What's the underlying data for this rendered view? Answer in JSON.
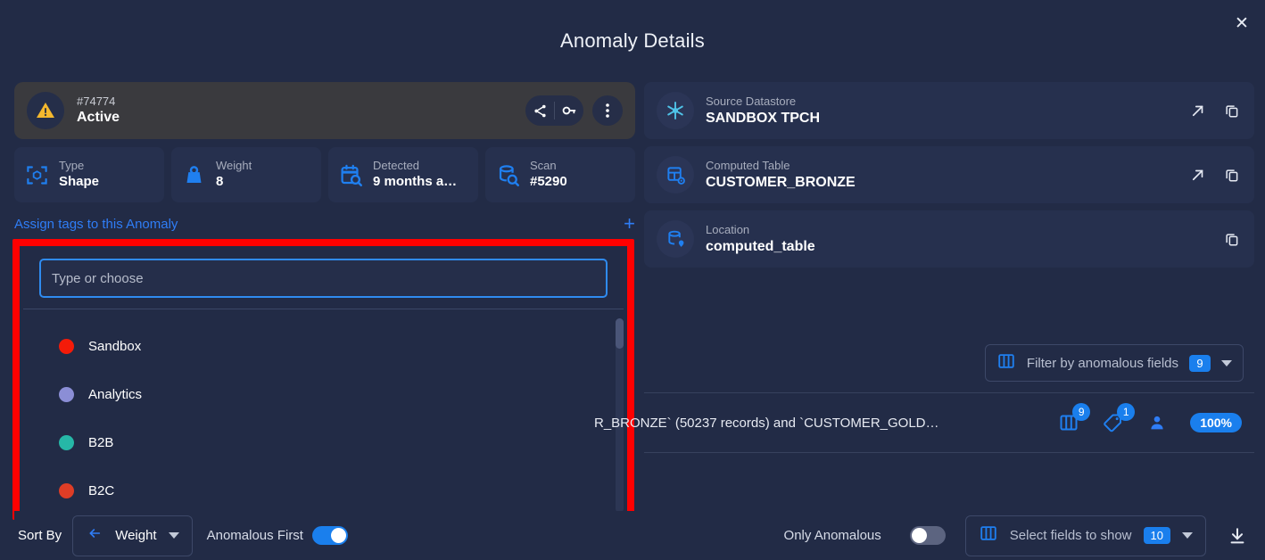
{
  "header": {
    "title": "Anomaly Details",
    "close_label": "✕"
  },
  "status": {
    "id": "#74774",
    "state": "Active",
    "icon": "warning-triangle-icon",
    "actions": [
      "share-icon",
      "key-icon",
      "more-vertical-icon"
    ]
  },
  "metrics": [
    {
      "label": "Type",
      "value": "Shape",
      "icon": "shape-scan-icon"
    },
    {
      "label": "Weight",
      "value": "8",
      "icon": "weight-icon"
    },
    {
      "label": "Detected",
      "value": "9 months a…",
      "icon": "calendar-search-icon"
    },
    {
      "label": "Scan",
      "value": "#5290",
      "icon": "database-search-icon"
    }
  ],
  "tags_section": {
    "assign_label": "Assign tags to this Anomaly",
    "add_label": "+",
    "input_placeholder": "Type or choose",
    "input_value": "",
    "options": [
      {
        "label": "Sandbox",
        "color": "#f41b09"
      },
      {
        "label": "Analytics",
        "color": "#8b8ed6"
      },
      {
        "label": "B2B",
        "color": "#26b7a7"
      },
      {
        "label": "B2C",
        "color": "#de3d26"
      }
    ],
    "highlight_color": "#ff0000"
  },
  "info_cards": [
    {
      "label": "Source Datastore",
      "value": "SANDBOX TPCH",
      "icon": "snowflake-icon",
      "actions": [
        "open-external-icon",
        "copy-icon"
      ]
    },
    {
      "label": "Computed Table",
      "value": "CUSTOMER_BRONZE",
      "icon": "computed-table-icon",
      "actions": [
        "open-external-icon",
        "copy-icon"
      ]
    },
    {
      "label": "Location",
      "value": "computed_table",
      "icon": "database-pin-icon",
      "actions": [
        "copy-icon"
      ]
    }
  ],
  "filter": {
    "label": "Filter by anomalous fields",
    "count": "9",
    "icon": "columns-icon"
  },
  "record": {
    "text": "R_BRONZE` (50237 records) and `CUSTOMER_GOLD…",
    "badges": [
      {
        "icon": "columns-icon",
        "count": "9"
      },
      {
        "icon": "tag-icon",
        "count": "1"
      },
      {
        "icon": "user-icon",
        "count": ""
      }
    ],
    "percent": "100%"
  },
  "bottom": {
    "sort_by_label": "Sort By",
    "sort_direction_icon": "arrow-left-icon",
    "sort_value": "Weight",
    "anomalous_first_label": "Anomalous First",
    "anomalous_first_on": true,
    "only_anomalous_label": "Only Anomalous",
    "only_anomalous_on": false,
    "select_fields_label": "Select fields to show",
    "select_fields_count": "10",
    "download_icon": "download-icon"
  },
  "colors": {
    "background": "#222b46",
    "card": "#26304e",
    "status_card": "#3a3a3e",
    "accent": "#1a7fed",
    "link": "#2f7df6",
    "highlight": "#ff0000"
  }
}
